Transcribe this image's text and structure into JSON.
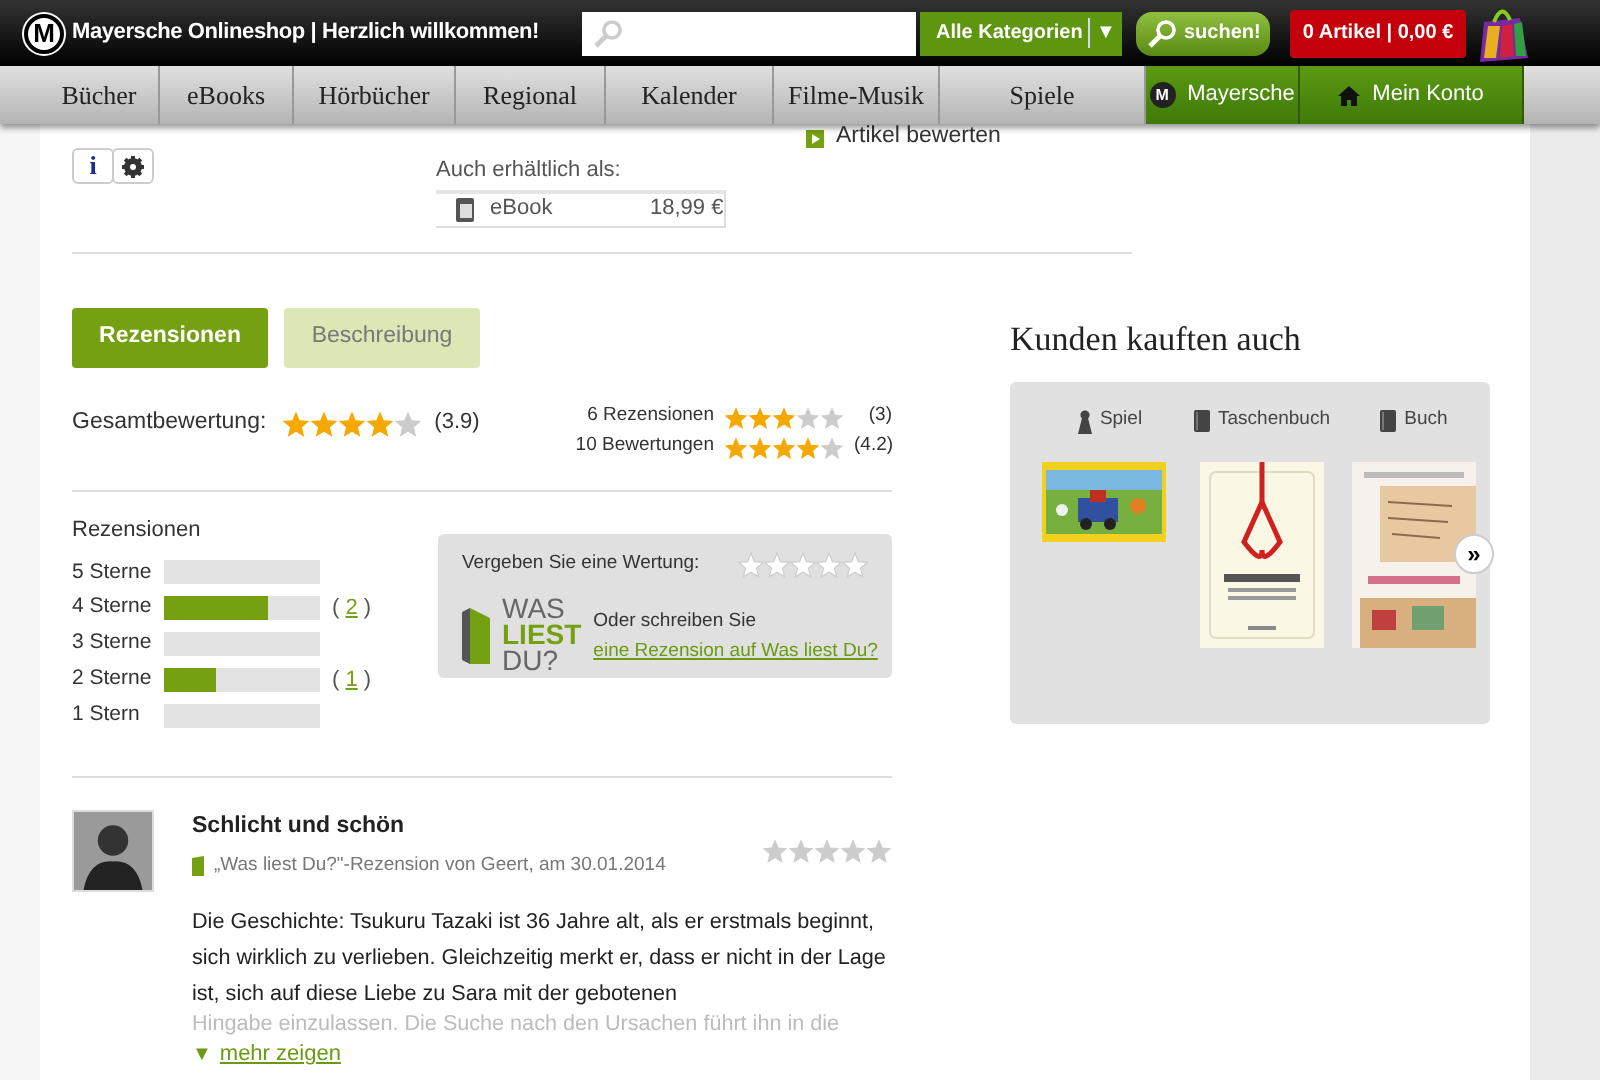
{
  "header": {
    "logo": "M",
    "title": "Mayersche Onlineshop | Herzlich willkommen!",
    "category": "Alle Kategorien",
    "category_caret": "▼",
    "search_button": "suchen!",
    "cart": "0 Artikel | 0,00 €"
  },
  "nav": [
    {
      "label": "Bücher",
      "kind": "category"
    },
    {
      "label": "eBooks",
      "kind": "category"
    },
    {
      "label": "Hörbücher",
      "kind": "category"
    },
    {
      "label": "Regional",
      "kind": "category"
    },
    {
      "label": "Kalender",
      "kind": "category"
    },
    {
      "label": "Filme-Musik",
      "kind": "category"
    },
    {
      "label": "Spiele",
      "kind": "category"
    },
    {
      "label": "Mayersche",
      "kind": "shop",
      "icon": "M"
    },
    {
      "label": "Mein Konto",
      "kind": "account"
    }
  ],
  "product": {
    "info_button": "i",
    "also_available_label": "Auch erhältlich als:",
    "formats": [
      {
        "name": "eBook",
        "price": "18,99 €"
      }
    ],
    "rate_link": "Artikel bewerten"
  },
  "tabs": [
    {
      "label": "Rezensionen",
      "selected": true
    },
    {
      "label": "Beschreibung",
      "selected": false
    }
  ],
  "overall": {
    "label": "Gesamtbewertung:",
    "stars": 4,
    "value": "(3.9)"
  },
  "summaries": [
    {
      "label": "6 Rezensionen",
      "stars": 3,
      "value": "(3)"
    },
    {
      "label": "10 Bewertungen",
      "stars": 4,
      "value": "(4.2)"
    }
  ],
  "distribution": {
    "title": "Rezensionen",
    "rows": [
      {
        "label": "5 Sterne"
      },
      {
        "label": "4 Sterne",
        "level": 0.67,
        "open": "(",
        "count": "2",
        "close": ")"
      },
      {
        "label": "3 Sterne"
      },
      {
        "label": "2 Sterne",
        "level": 0.33,
        "open": "(",
        "count": "1",
        "close": ")"
      },
      {
        "label": "1 Stern"
      }
    ]
  },
  "rate_box": {
    "label": "Vergeben Sie eine Wertung:",
    "stars": 0,
    "logo_top": "WAS",
    "logo_bottom": "**LIEST** DU?",
    "text": "Oder schreiben Sie",
    "link": "eine Rezension auf Was liest Du?"
  },
  "review": {
    "title": "Schlicht und schön",
    "meta": "„Was liest Du?\"-Rezension von Geert, am 30.01.2014",
    "stars": 0,
    "text": "Die Geschichte: Tsukuru Tazaki ist 36 Jahre alt, als er erstmals beginnt, sich wirklich zu verlieben. Gleichzeitig merkt er, dass er nicht in der Lage ist, sich auf diese Liebe zu Sara mit der gebotenen",
    "faded_text": "Hingabe einzulassen. Die Suche nach den Ursachen führt ihn in die",
    "more_caret": "▼",
    "more": "mehr zeigen"
  },
  "also_bought": {
    "title": "Kunden kauften auch",
    "items": [
      {
        "kind": "game",
        "label": "Spiel"
      },
      {
        "kind": "book",
        "label": "Taschenbuch"
      },
      {
        "kind": "book",
        "label": "Buch"
      }
    ],
    "next": "»"
  }
}
